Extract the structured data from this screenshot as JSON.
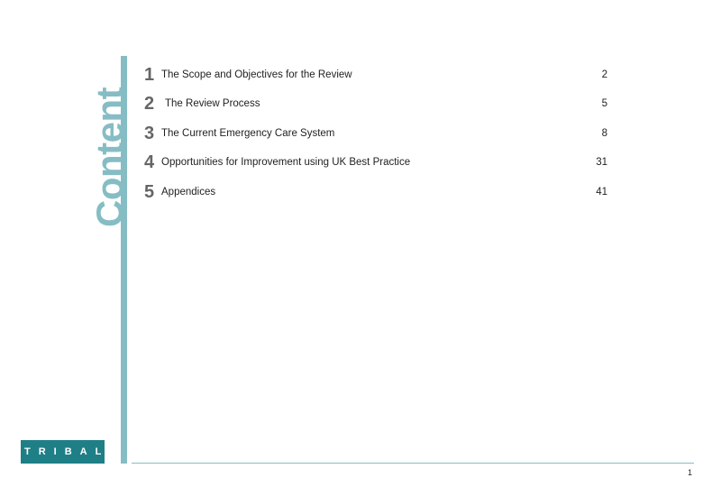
{
  "side_title": "Content",
  "toc": [
    {
      "number": "1",
      "title": "The Scope and Objectives for the Review",
      "page": "2"
    },
    {
      "number": "2",
      "title": "The Review Process",
      "page": "5"
    },
    {
      "number": "3",
      "title": "The Current Emergency Care System",
      "page": "8"
    },
    {
      "number": "4",
      "title": "Opportunities for Improvement using UK Best Practice",
      "page": "31"
    },
    {
      "number": "5",
      "title": "Appendices",
      "page": "41"
    }
  ],
  "logo": {
    "text": "TRIBAL"
  },
  "footer": {
    "page_number": "1"
  },
  "colors": {
    "accent": "#86bdc4",
    "logo_bg": "#1f7f86",
    "number_gray": "#666666"
  }
}
